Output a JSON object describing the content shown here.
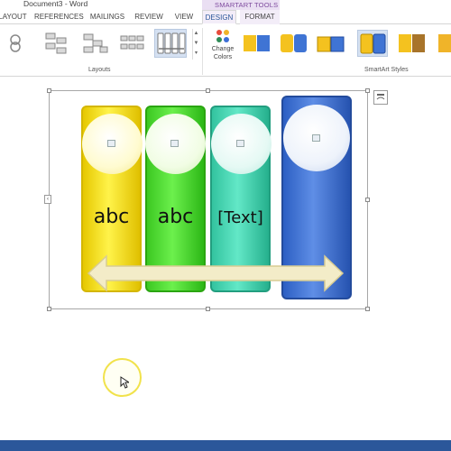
{
  "title_bar": {
    "document_title": "Document3 - Word",
    "context_group": "SMARTART TOOLS"
  },
  "tabs": [
    {
      "label": "LAYOUT"
    },
    {
      "label": "REFERENCES"
    },
    {
      "label": "MAILINGS"
    },
    {
      "label": "REVIEW"
    },
    {
      "label": "VIEW"
    },
    {
      "label": "DESIGN",
      "active": true
    },
    {
      "label": "FORMAT"
    }
  ],
  "ribbon": {
    "layouts_group_label": "Layouts",
    "change_colors_label_line1": "Change",
    "change_colors_label_line2": "Colors",
    "smartart_styles_group_label": "SmartArt Styles"
  },
  "smartart": {
    "columns": [
      {
        "text": "abc",
        "color": "#f4e20c"
      },
      {
        "text": "abc",
        "color": "#4fd733"
      },
      {
        "text": "[Text]",
        "color": "#3fd2ad"
      },
      {
        "text": "",
        "color": "#3f74d4"
      }
    ],
    "arrow_color": "#f3ecc8"
  },
  "colors": {
    "accent": "#2b579a",
    "context_tab": "#7e4a9e",
    "cursor_highlight": "#f1e24b"
  }
}
